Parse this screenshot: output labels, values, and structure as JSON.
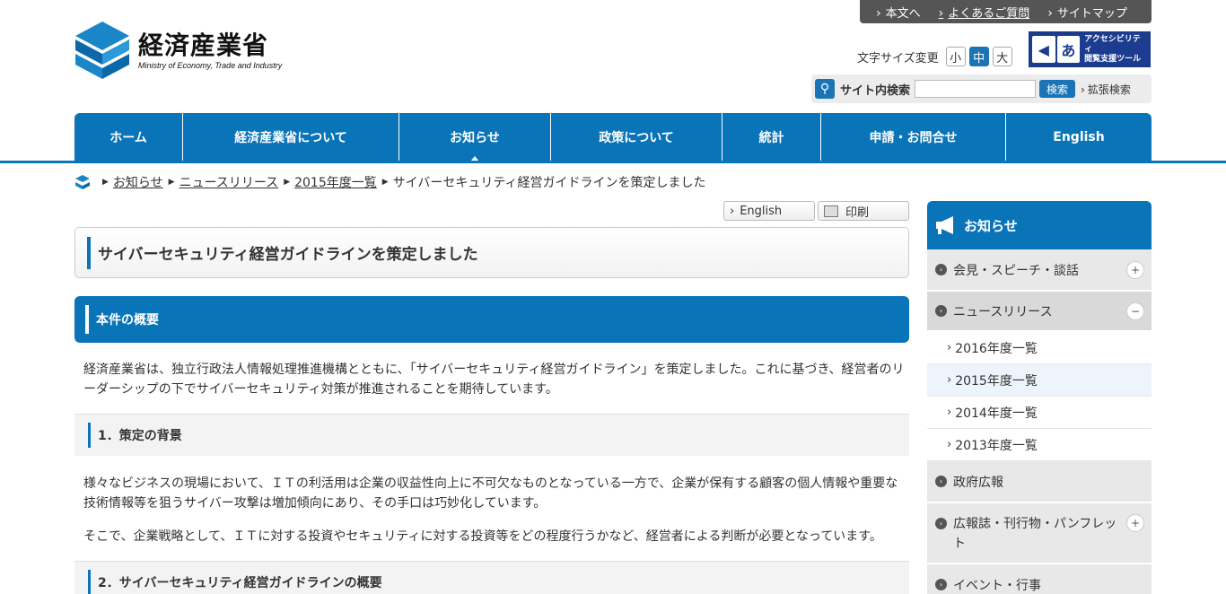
{
  "util_links": [
    "本文へ",
    "よくあるご質問",
    "サイトマップ"
  ],
  "logo": {
    "jp": "経済産業省",
    "en": "Ministry of Economy, Trade and Industry"
  },
  "font_size": {
    "label": "文字サイズ変更",
    "small": "小",
    "medium": "中",
    "large": "大"
  },
  "accessibility": {
    "icon": "あ",
    "line1": "アクセシビリティ",
    "line2": "閲覧支援ツール"
  },
  "search": {
    "label": "サイト内検索",
    "value": "",
    "button": "検索",
    "extended": "拡張検索"
  },
  "nav": [
    "ホーム",
    "経済産業省について",
    "お知らせ",
    "政策について",
    "統計",
    "申請・お問合せ",
    "English"
  ],
  "breadcrumb": [
    "お知らせ",
    "ニュースリリース",
    "2015年度一覧",
    "サイバーセキュリティ経営ガイドラインを策定しました"
  ],
  "tools": {
    "english": "English",
    "print": "印刷"
  },
  "page_title": "サイバーセキュリティ経営ガイドラインを策定しました",
  "section1": {
    "title": "本件の概要",
    "body": "経済産業省は、独立行政法人情報処理推進機構とともに、「サイバーセキュリティ経営ガイドライン」を策定しました。これに基づき、経営者のリーダーシップの下でサイバーセキュリティ対策が推進されることを期待しています。"
  },
  "section2": {
    "title": "1．策定の背景",
    "body1": "様々なビジネスの現場において、ＩＴの利活用は企業の収益性向上に不可欠なものとなっている一方で、企業が保有する顧客の個人情報や重要な技術情報等を狙うサイバー攻撃は増加傾向にあり、その手口は巧妙化しています。",
    "body2": "そこで、企業戦略として、ＩＴに対する投資やセキュリティに対する投資等をどの程度行うかなど、経営者による判断が必要となっています。"
  },
  "section3": {
    "title": "2．サイバーセキュリティ経営ガイドラインの概要"
  },
  "sidebar": {
    "title": "お知らせ",
    "items": [
      {
        "label": "会見・スピーチ・談話"
      },
      {
        "label": "ニュースリリース"
      },
      {
        "label": "2016年度一覧"
      },
      {
        "label": "2015年度一覧"
      },
      {
        "label": "2014年度一覧"
      },
      {
        "label": "2013年度一覧"
      },
      {
        "label": "政府広報"
      },
      {
        "label": "広報誌・刊行物・パンフレット"
      },
      {
        "label": "イベント・行事"
      }
    ]
  },
  "colors": {
    "brand": "#0a74b8",
    "util_bar": "#555555"
  }
}
